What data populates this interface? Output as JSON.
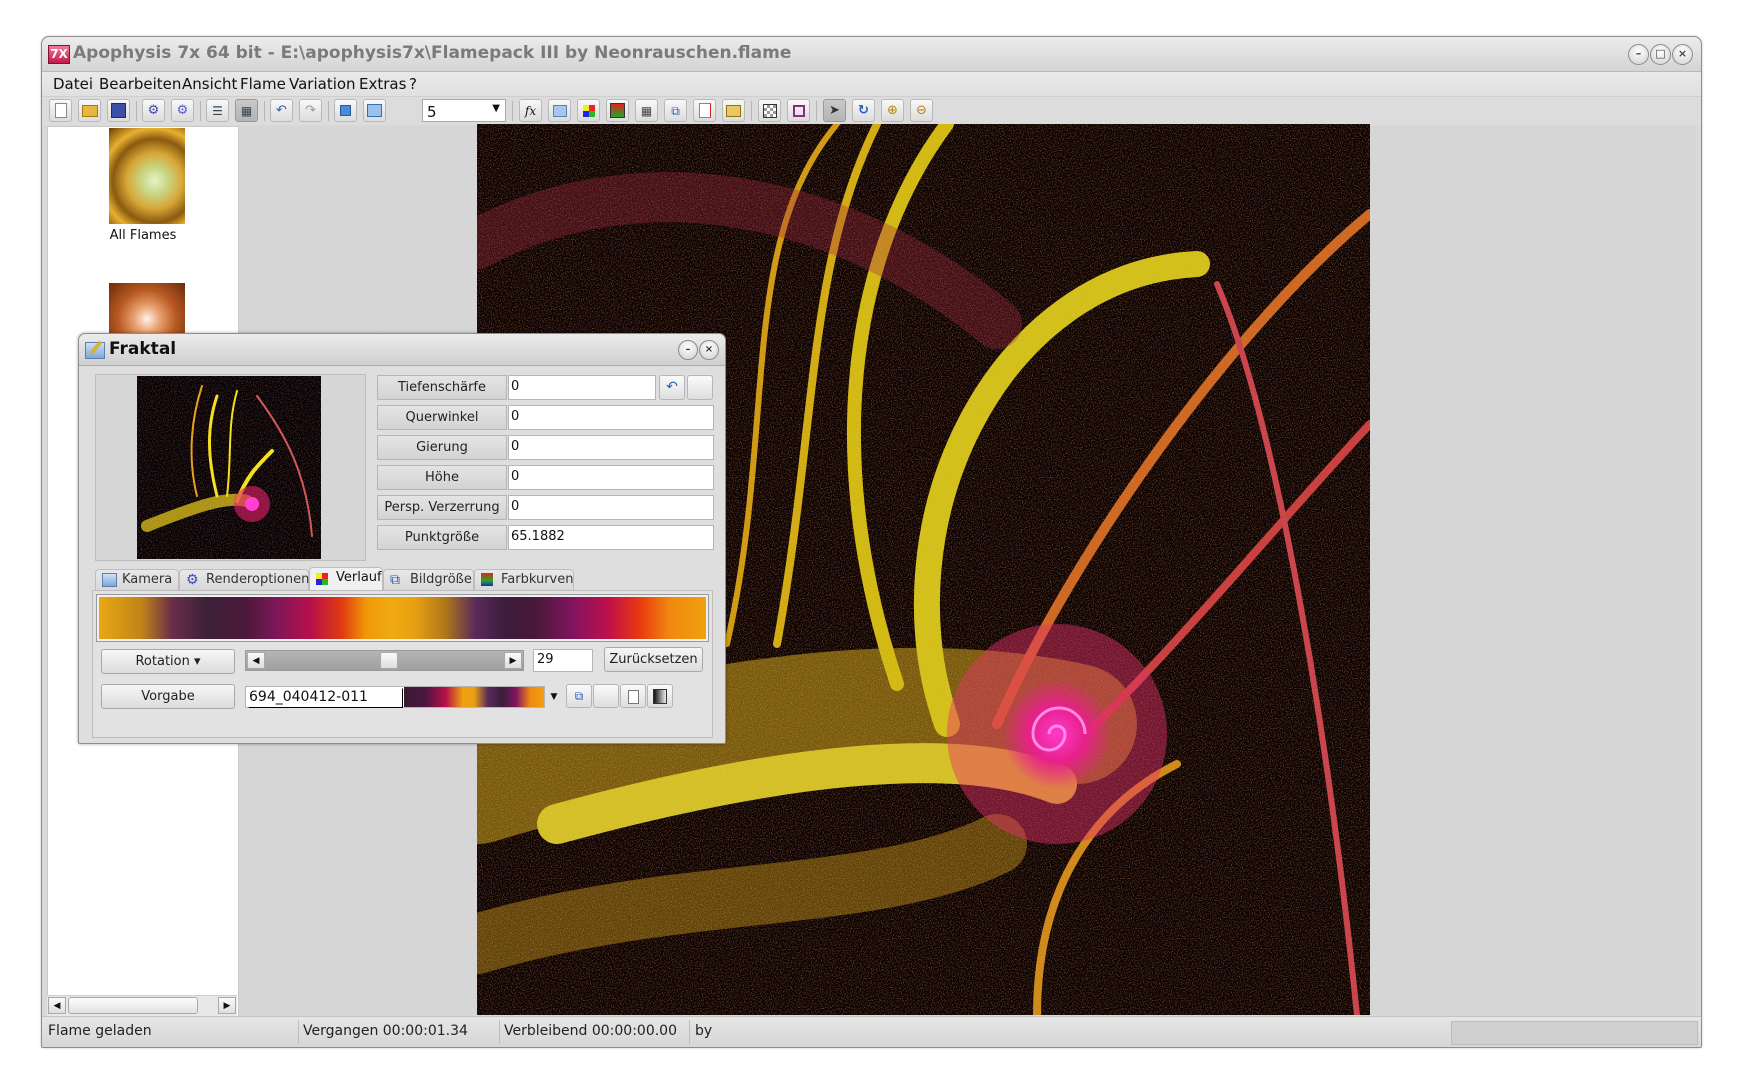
{
  "window": {
    "app_icon": "7X",
    "title": "Apophysis 7x 64 bit - E:\\apophysis7x\\Flamepack III by Neonrauschen.flame",
    "controls": {
      "minimize": "–",
      "maximize": "□",
      "close": "×"
    }
  },
  "menu": [
    "Datei",
    "Bearbeiten",
    "Ansicht",
    "Flame",
    "Variation",
    "Extras",
    "?"
  ],
  "toolbar": {
    "buttons": [
      "new-icon",
      "open-folder-icon",
      "save-icon",
      "render-gear-icon",
      "batch-render-icon",
      "list-view-icon",
      "icon-view-icon",
      "undo-icon",
      "redo-icon",
      "fullscreen-icon",
      "preview-icon",
      "formula-icon",
      "edit-icon",
      "palette-icon",
      "gradient-icon",
      "mutate-icon",
      "adjust-icon",
      "script-icon",
      "options-icon",
      "transparency-icon",
      "frame-icon",
      "select-icon",
      "rotate-icon",
      "zoom-in-icon",
      "zoom-out-icon"
    ],
    "quality_value": "5"
  },
  "sidebar": {
    "items": [
      {
        "label": "All Flames"
      },
      {
        "label": ""
      }
    ]
  },
  "status": {
    "message": "Flame geladen",
    "elapsed": "Vergangen 00:00:01.34",
    "remaining": "Verbleibend 00:00:00.00",
    "author": "by"
  },
  "dialog": {
    "title": "Fraktal",
    "params": [
      {
        "label": "Tiefenschärfe",
        "value": "0"
      },
      {
        "label": "Querwinkel",
        "value": "0"
      },
      {
        "label": "Gierung",
        "value": "0"
      },
      {
        "label": "Höhe",
        "value": "0"
      },
      {
        "label": "Persp. Verzerrung",
        "value": "0"
      },
      {
        "label": "Punktgröße",
        "value": "65.1882"
      }
    ],
    "tabs": [
      {
        "label": "Kamera",
        "icon": "edit-icon"
      },
      {
        "label": "Renderoptionen",
        "icon": "gear-icon"
      },
      {
        "label": "Verlauf",
        "icon": "palette-icon",
        "active": true
      },
      {
        "label": "Bildgröße",
        "icon": "resize-icon"
      },
      {
        "label": "Farbkurven",
        "icon": "color-curves-icon"
      }
    ],
    "gradient": {
      "rotation_button": "Rotation ▾",
      "rotation_value": "29",
      "rotation_fraction": 0.52,
      "reset_button": "Zurücksetzen",
      "preset_button": "Vorgabe",
      "preset_value": "694_040412-011"
    }
  }
}
